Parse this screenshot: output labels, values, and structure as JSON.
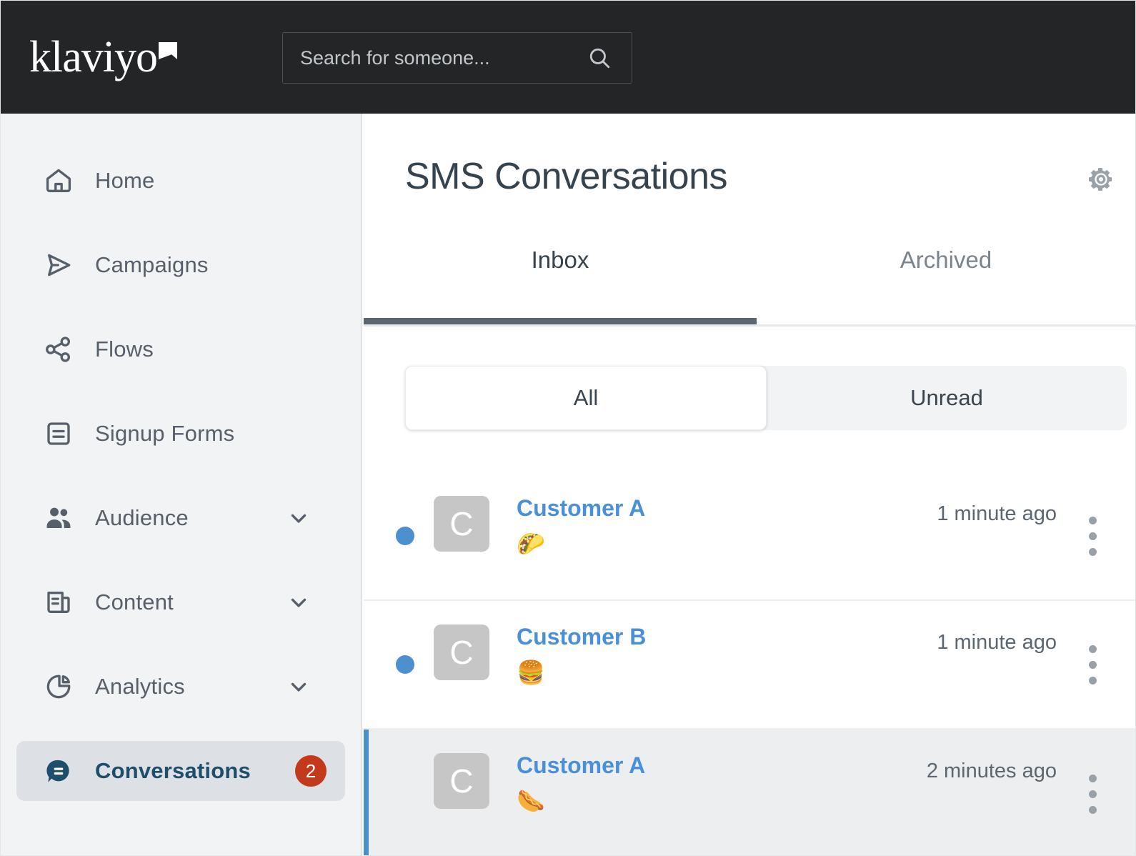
{
  "brand": {
    "logo_text": "klaviyo",
    "accent_blue": "#4a90d9",
    "badge_red": "#c3391c",
    "active_navy": "#1d4e6b"
  },
  "topbar": {
    "search_placeholder": "Search for someone...",
    "search_value": ""
  },
  "sidebar": {
    "items": [
      {
        "label": "Home",
        "icon": "home-icon",
        "expandable": false,
        "active": false
      },
      {
        "label": "Campaigns",
        "icon": "send-icon",
        "expandable": false,
        "active": false
      },
      {
        "label": "Flows",
        "icon": "flows-icon",
        "expandable": false,
        "active": false
      },
      {
        "label": "Signup Forms",
        "icon": "signup-forms-icon",
        "expandable": false,
        "active": false
      },
      {
        "label": "Audience",
        "icon": "audience-icon",
        "expandable": true,
        "active": false
      },
      {
        "label": "Content",
        "icon": "content-icon",
        "expandable": true,
        "active": false
      },
      {
        "label": "Analytics",
        "icon": "analytics-icon",
        "expandable": true,
        "active": false
      },
      {
        "label": "Conversations",
        "icon": "conversations-icon",
        "expandable": false,
        "active": true,
        "badge": "2"
      }
    ]
  },
  "main": {
    "title": "SMS Conversations",
    "settings_icon": "gear-icon",
    "tabs": [
      {
        "label": "Inbox",
        "active": true
      },
      {
        "label": "Archived",
        "active": false
      }
    ],
    "filters": [
      {
        "label": "All",
        "active": true
      },
      {
        "label": "Unread",
        "active": false
      }
    ],
    "conversations": [
      {
        "name": "Customer A",
        "avatar_letter": "C",
        "preview": "🌮",
        "time": "1 minute ago",
        "unread": true,
        "selected": false
      },
      {
        "name": "Customer B",
        "avatar_letter": "C",
        "preview": "🍔",
        "time": "1 minute ago",
        "unread": true,
        "selected": false
      },
      {
        "name": "Customer A",
        "avatar_letter": "C",
        "preview": "🌭",
        "time": "2 minutes ago",
        "unread": false,
        "selected": true
      }
    ]
  }
}
